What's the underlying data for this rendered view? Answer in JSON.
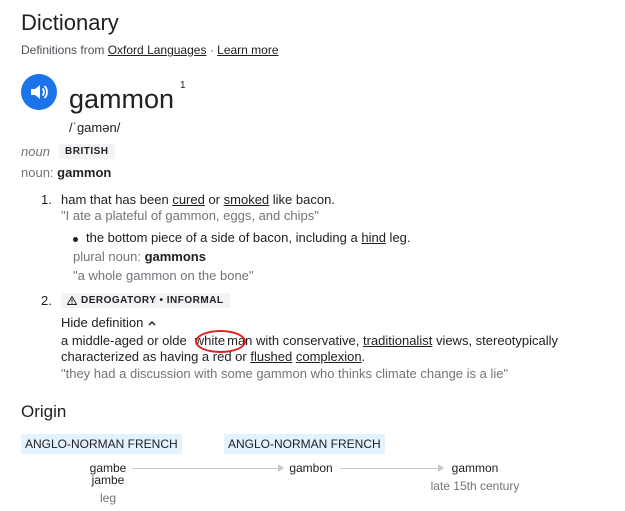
{
  "header": {
    "title": "Dictionary",
    "definitions_prefix": "Definitions from",
    "source_link": "Oxford Languages",
    "separator": "·",
    "learn_more": "Learn more"
  },
  "entry": {
    "word": "gammon",
    "superscript": "1",
    "phonetic": "/ˈɡamən/",
    "part_of_speech": "noun",
    "region": "BRITISH",
    "noun_label": "noun:",
    "noun_word": "gammon"
  },
  "senses": [
    {
      "number": "1.",
      "def_a": "ham that has been ",
      "link_1": "cured",
      "def_b": " or ",
      "link_2": "smoked",
      "def_c": " like bacon.",
      "example": "\"I ate a plateful of gammon, eggs, and chips\"",
      "subsense": {
        "def_a": "the bottom piece of a side of bacon, including a ",
        "link": "hind",
        "def_b": " leg.",
        "plural_label": "plural noun: ",
        "plural_word": "gammons",
        "example": "\"a whole gammon on the bone\""
      }
    },
    {
      "number": "2.",
      "tag": "DEROGATORY • INFORMAL",
      "hide_label": "Hide definition",
      "line1_a": "a middle-aged or olde",
      "line1_b": "white",
      "line1_c": "man with conservative, ",
      "line1_link": "traditionalist",
      "line1_d": " views, stereotypically",
      "line2_a": "characterized as having a red or ",
      "line2_link1": "flushed",
      "line2_link2": "complexion",
      "line2_end": ".",
      "example": "\"they had a discussion with some gammon who thinks climate change is a lie\""
    }
  ],
  "origin": {
    "heading": "Origin",
    "tag_1": "ANGLO-NORMAN FRENCH",
    "tag_2": "ANGLO-NORMAN FRENCH",
    "word_1": "gambe",
    "word_1b": "jambe",
    "gloss_1": "leg",
    "word_2": "gambon",
    "word_3": "gammon",
    "date_3": "late 15th century"
  },
  "colors": {
    "accent": "#1a73e8",
    "etymology_tag": "#e3f2fd",
    "annotation_circle": "#e02020"
  },
  "icons": {
    "speaker": "volume-icon",
    "warning": "warning-triangle-icon",
    "chevron": "chevron-up-icon"
  }
}
